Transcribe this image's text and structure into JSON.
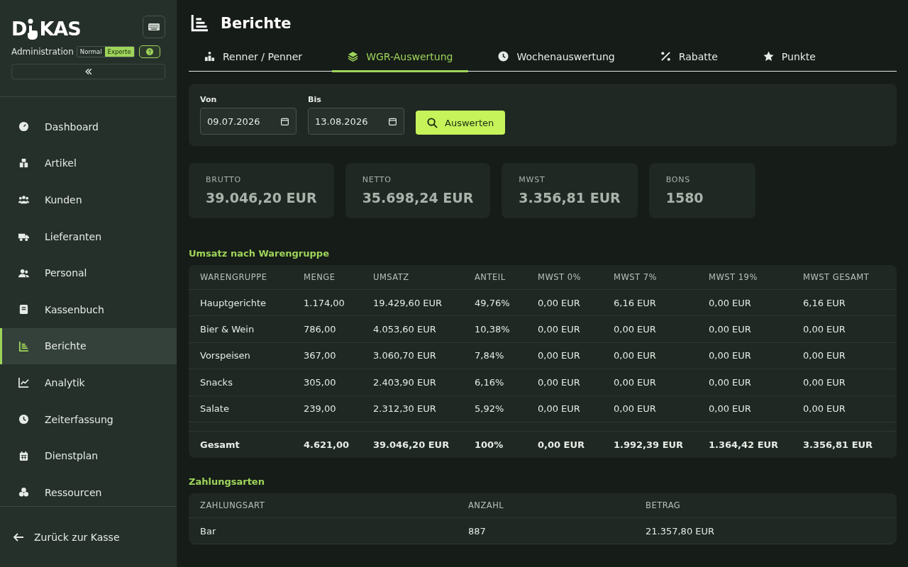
{
  "sidebar": {
    "logo": {
      "before": "D",
      "after": "KAS"
    },
    "subtitle": "Administration",
    "modes": [
      {
        "label": "Normal",
        "selected": false
      },
      {
        "label": "Experte",
        "selected": true
      }
    ],
    "items": [
      {
        "label": "Dashboard",
        "selected": false
      },
      {
        "label": "Artikel",
        "selected": false
      },
      {
        "label": "Kunden",
        "selected": false
      },
      {
        "label": "Lieferanten",
        "selected": false
      },
      {
        "label": "Personal",
        "selected": false
      },
      {
        "label": "Kassenbuch",
        "selected": false
      },
      {
        "label": "Berichte",
        "selected": true
      },
      {
        "label": "Analytik",
        "selected": false
      },
      {
        "label": "Zeiterfassung",
        "selected": false
      },
      {
        "label": "Dienstplan",
        "selected": false
      },
      {
        "label": "Ressourcen",
        "selected": false
      }
    ],
    "back_link": "Zurück zur Kasse"
  },
  "page": {
    "title": "Berichte"
  },
  "tabs": [
    {
      "label": "Renner / Penner",
      "selected": false
    },
    {
      "label": "WGR-Auswertung",
      "selected": true
    },
    {
      "label": "Wochenauswertung",
      "selected": false
    },
    {
      "label": "Rabatte",
      "selected": false
    },
    {
      "label": "Punkte",
      "selected": false
    }
  ],
  "filter": {
    "from": {
      "label": "Von",
      "value": "09.07.2026"
    },
    "to": {
      "label": "Bis",
      "value": "13.08.2026"
    },
    "button": "Auswerten"
  },
  "stats": [
    {
      "label": "BRUTTO",
      "value": "39.046,20 EUR"
    },
    {
      "label": "NETTO",
      "value": "35.698,24 EUR"
    },
    {
      "label": "MWST",
      "value": "3.356,81 EUR"
    },
    {
      "label": "BONS",
      "value": "1580"
    }
  ],
  "groups_table": {
    "title": "Umsatz nach Warengruppe",
    "columns": [
      "WARENGRUPPE",
      "MENGE",
      "UMSATZ",
      "ANTEIL",
      "MWST 0%",
      "MWST 7%",
      "MWST 19%",
      "MWST GESAMT"
    ],
    "rows": [
      [
        "Hauptgerichte",
        "1.174,00",
        "19.429,60 EUR",
        "49,76%",
        "0,00 EUR",
        "6,16 EUR",
        "0,00 EUR",
        "6,16 EUR"
      ],
      [
        "Bier & Wein",
        "786,00",
        "4.053,60 EUR",
        "10,38%",
        "0,00 EUR",
        "0,00 EUR",
        "0,00 EUR",
        "0,00 EUR"
      ],
      [
        "Vorspeisen",
        "367,00",
        "3.060,70 EUR",
        "7,84%",
        "0,00 EUR",
        "0,00 EUR",
        "0,00 EUR",
        "0,00 EUR"
      ],
      [
        "Snacks",
        "305,00",
        "2.403,90 EUR",
        "6,16%",
        "0,00 EUR",
        "0,00 EUR",
        "0,00 EUR",
        "0,00 EUR"
      ],
      [
        "Salate",
        "239,00",
        "2.312,30 EUR",
        "5,92%",
        "0,00 EUR",
        "0,00 EUR",
        "0,00 EUR",
        "0,00 EUR"
      ]
    ],
    "total": [
      "Gesamt",
      "4.621,00",
      "39.046,20 EUR",
      "100%",
      "0,00 EUR",
      "1.992,39 EUR",
      "1.364,42 EUR",
      "3.356,81 EUR"
    ]
  },
  "payments_table": {
    "title": "Zahlungsarten",
    "columns": [
      "ZAHLUNGSART",
      "ANZAHL",
      "BETRAG"
    ],
    "rows": [
      [
        "Bar",
        "887",
        "21.357,80 EUR"
      ]
    ]
  }
}
